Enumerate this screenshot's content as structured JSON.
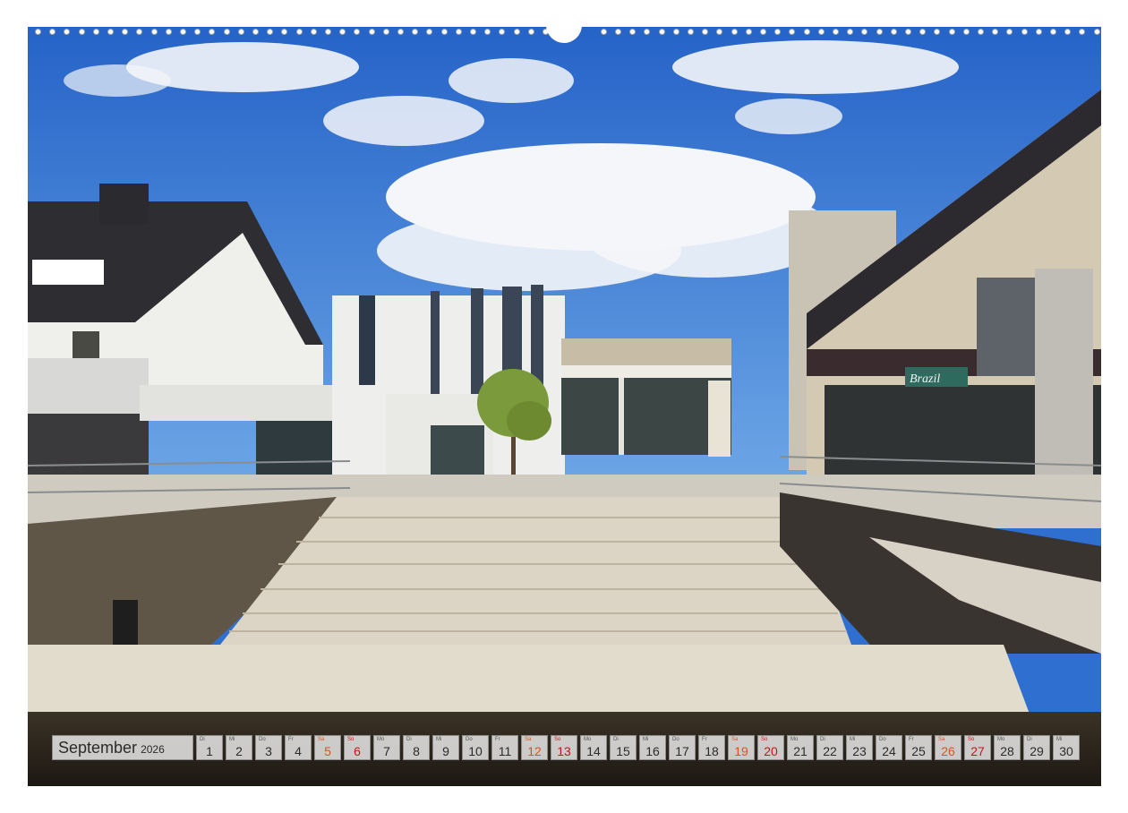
{
  "calendar": {
    "month": "September",
    "year": "2026",
    "days": [
      {
        "wd": "Di",
        "d": "1",
        "type": "weekday"
      },
      {
        "wd": "Mi",
        "d": "2",
        "type": "weekday"
      },
      {
        "wd": "Do",
        "d": "3",
        "type": "weekday"
      },
      {
        "wd": "Fr",
        "d": "4",
        "type": "weekday"
      },
      {
        "wd": "Sa",
        "d": "5",
        "type": "sat"
      },
      {
        "wd": "So",
        "d": "6",
        "type": "sun"
      },
      {
        "wd": "Mo",
        "d": "7",
        "type": "weekday"
      },
      {
        "wd": "Di",
        "d": "8",
        "type": "weekday"
      },
      {
        "wd": "Mi",
        "d": "9",
        "type": "weekday"
      },
      {
        "wd": "Do",
        "d": "10",
        "type": "weekday"
      },
      {
        "wd": "Fr",
        "d": "11",
        "type": "weekday"
      },
      {
        "wd": "Sa",
        "d": "12",
        "type": "sat"
      },
      {
        "wd": "So",
        "d": "13",
        "type": "sun"
      },
      {
        "wd": "Mo",
        "d": "14",
        "type": "weekday"
      },
      {
        "wd": "Di",
        "d": "15",
        "type": "weekday"
      },
      {
        "wd": "Mi",
        "d": "16",
        "type": "weekday"
      },
      {
        "wd": "Do",
        "d": "17",
        "type": "weekday"
      },
      {
        "wd": "Fr",
        "d": "18",
        "type": "weekday"
      },
      {
        "wd": "Sa",
        "d": "19",
        "type": "sat"
      },
      {
        "wd": "So",
        "d": "20",
        "type": "sun"
      },
      {
        "wd": "Mo",
        "d": "21",
        "type": "weekday"
      },
      {
        "wd": "Di",
        "d": "22",
        "type": "weekday"
      },
      {
        "wd": "Mi",
        "d": "23",
        "type": "weekday"
      },
      {
        "wd": "Do",
        "d": "24",
        "type": "weekday"
      },
      {
        "wd": "Fr",
        "d": "25",
        "type": "weekday"
      },
      {
        "wd": "Sa",
        "d": "26",
        "type": "sat"
      },
      {
        "wd": "So",
        "d": "27",
        "type": "sun"
      },
      {
        "wd": "Mo",
        "d": "28",
        "type": "weekday"
      },
      {
        "wd": "Di",
        "d": "29",
        "type": "weekday"
      },
      {
        "wd": "Mi",
        "d": "30",
        "type": "weekday"
      }
    ]
  },
  "photo": {
    "shop_sign": "Brazil",
    "colors": {
      "sky": "#2f6fcf",
      "cloud": "#f4f6fa",
      "stone": "#d9d2c3",
      "wall": "#efefec",
      "water": "#2a241c"
    }
  }
}
